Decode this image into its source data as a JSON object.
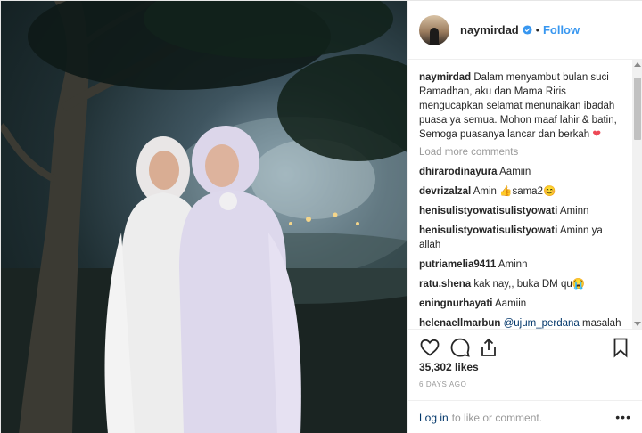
{
  "post": {
    "username": "naymirdad",
    "follow_label": "Follow",
    "separator": "•",
    "caption_user": "naymirdad",
    "caption_text": "Dalam menyambut bulan suci Ramadhan, aku dan Mama Riris mengucapkan selamat menunaikan ibadah puasa ya semua. Mohon maaf lahir & batin, Semoga puasanya lancar dan berkah",
    "caption_emoji": "❤",
    "load_more": "Load more comments",
    "comments": [
      {
        "user": "dhirarodinayura",
        "text": "Aamiin"
      },
      {
        "user": "devrizalzal",
        "text": "Amin 👍sama2😊"
      },
      {
        "user": "henisulistyowatisulistyowati",
        "text": "Aminn"
      },
      {
        "user": "henisulistyowatisulistyowati",
        "text": "Aminn ya allah"
      },
      {
        "user": "putriamelia9411",
        "text": "Aminn"
      },
      {
        "user": "ratu.shena",
        "text": "kak nay,, buka DM qu😭"
      },
      {
        "user": "eningnurhayati",
        "text": "Aamiin"
      },
      {
        "user": "helenaellmarbun",
        "mention": "@ujum_perdana",
        "text": "masalah dosa, itu antara nay sma Tuhan"
      }
    ],
    "likes": "35,302 likes",
    "timestamp": "6 DAYS AGO",
    "login_label": "Log in",
    "login_suffix": "to like or comment.",
    "more_label": "•••",
    "icons": {
      "like": "heart-outline-icon",
      "comment": "comment-bubble-icon",
      "share": "share-icon",
      "save": "bookmark-icon",
      "verified": "verified-badge-icon"
    },
    "colors": {
      "accent": "#3897f0",
      "link": "#003569",
      "heart": "#ed4956"
    }
  }
}
